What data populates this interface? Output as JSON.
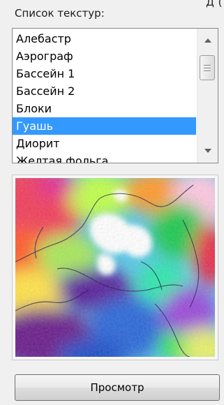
{
  "top_cut_text": "Д (",
  "texture_list": {
    "label": "Список текстур:",
    "items": [
      {
        "label": "Алебастр",
        "selected": false
      },
      {
        "label": "Аэрограф",
        "selected": false
      },
      {
        "label": "Бассейн 1",
        "selected": false
      },
      {
        "label": "Бассейн 2",
        "selected": false
      },
      {
        "label": "Блоки",
        "selected": false
      },
      {
        "label": "Гуашь",
        "selected": true
      },
      {
        "label": "Диорит",
        "selected": false
      },
      {
        "label": "Желтая фольга",
        "selected": false
      }
    ],
    "scrollbar": {
      "up_icon": "chevron-up-icon",
      "down_icon": "chevron-down-icon"
    }
  },
  "preview": {
    "texture_name": "Гуашь"
  },
  "buttons": {
    "preview_label": "Просмотр"
  },
  "colors": {
    "selection": "#3399ff",
    "background": "#f0f0f0"
  }
}
